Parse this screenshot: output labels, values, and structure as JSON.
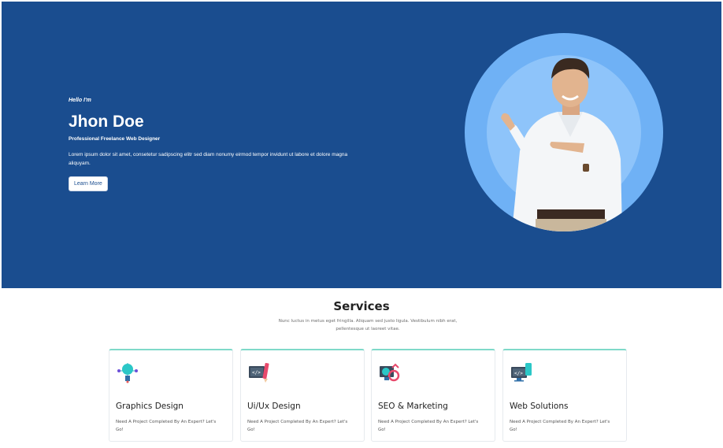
{
  "hero": {
    "greeting": "Hello I'm",
    "name": "Jhon Doe",
    "role": "Professional Freelance Web Designer",
    "description": "Lorem ipsum dolor sit amet, consetetur sadipscing elitr sed diam nonumy eirmod tempor invidunt ut labore et dolore magna aliquyam.",
    "button_label": "Learn More",
    "background_color": "#1a4d8f"
  },
  "services": {
    "title": "Services",
    "subtitle": "Nunc luctus in metus eget fringilla. Aliquam sed justo ligula. Vestibulum nibh erat, pellentesque ut laoreet vitae.",
    "cards": [
      {
        "title": "Graphics Design",
        "description": "Need A Project Completed By An Expert? Let's Go!",
        "icon": "graphics-design-icon"
      },
      {
        "title": "Ui/Ux Design",
        "description": "Need A Project Completed By An Expert? Let's Go!",
        "icon": "ui-ux-design-icon"
      },
      {
        "title": "SEO & Marketing",
        "description": "Need A Project Completed By An Expert? Let's Go!",
        "icon": "seo-marketing-icon"
      },
      {
        "title": "Web Solutions",
        "description": "Need A Project Completed By An Expert? Let's Go!",
        "icon": "web-solutions-icon"
      }
    ]
  }
}
